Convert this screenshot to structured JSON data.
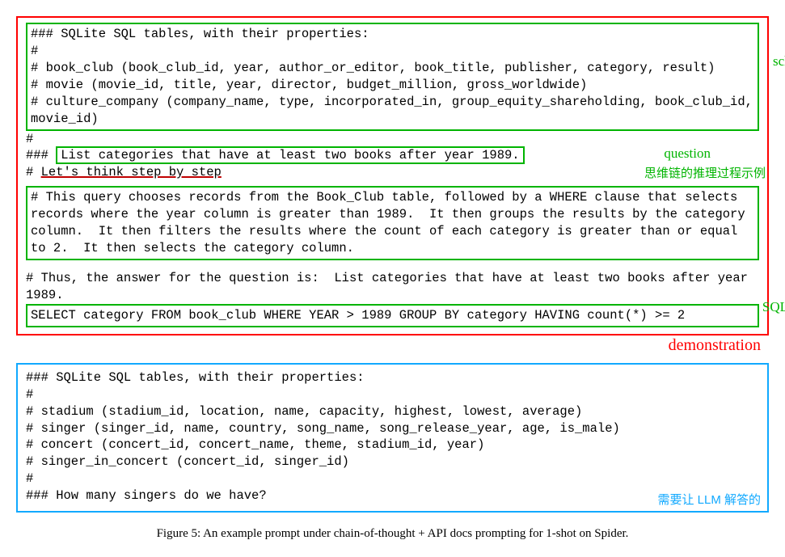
{
  "demo": {
    "schema_lines": "### SQLite SQL tables, with their properties:\n#\n# book_club (book_club_id, year, author_or_editor, book_title, publisher, category, result)\n# movie (movie_id, title, year, director, budget_million, gross_worldwide)\n# culture_company (company_name, type, incorporated_in, group_equity_shareholding, book_club_id, movie_id)",
    "hash1": "#",
    "hash_prefix": "### ",
    "question": "List categories that have at least two books after year 1989.",
    "cot_prefix": "# ",
    "cot_line": "Let's think step by step",
    "reasoning": "# This query chooses records from the Book_Club table, followed by a WHERE clause that selects records where the year column is greater than 1989.  It then groups the results by the category column.  It then filters the results where the count of each category is greater than or equal to 2.  It then selects the category column.",
    "answer_intro": "# Thus, the answer for the question is:  List categories that have at least two books after year 1989.",
    "sql": "SELECT category FROM book_club WHERE YEAR > 1989 GROUP BY category HAVING count(*) >= 2"
  },
  "labels": {
    "schema": "schema",
    "question": "question",
    "cot_cn": "思维链的推理过程示例",
    "sql": "SQL",
    "demonstration": "demonstration",
    "llm_cn": "需要让 LLM 解答的"
  },
  "query": {
    "body": "### SQLite SQL tables, with their properties:\n#\n# stadium (stadium_id, location, name, capacity, highest, lowest, average)\n# singer (singer_id, name, country, song_name, song_release_year, age, is_male)\n# concert (concert_id, concert_name, theme, stadium_id, year)\n# singer_in_concert (concert_id, singer_id)\n#\n### How many singers do we have?"
  },
  "caption": "Figure 5: An example prompt under chain-of-thought + API docs prompting for 1-shot on Spider."
}
